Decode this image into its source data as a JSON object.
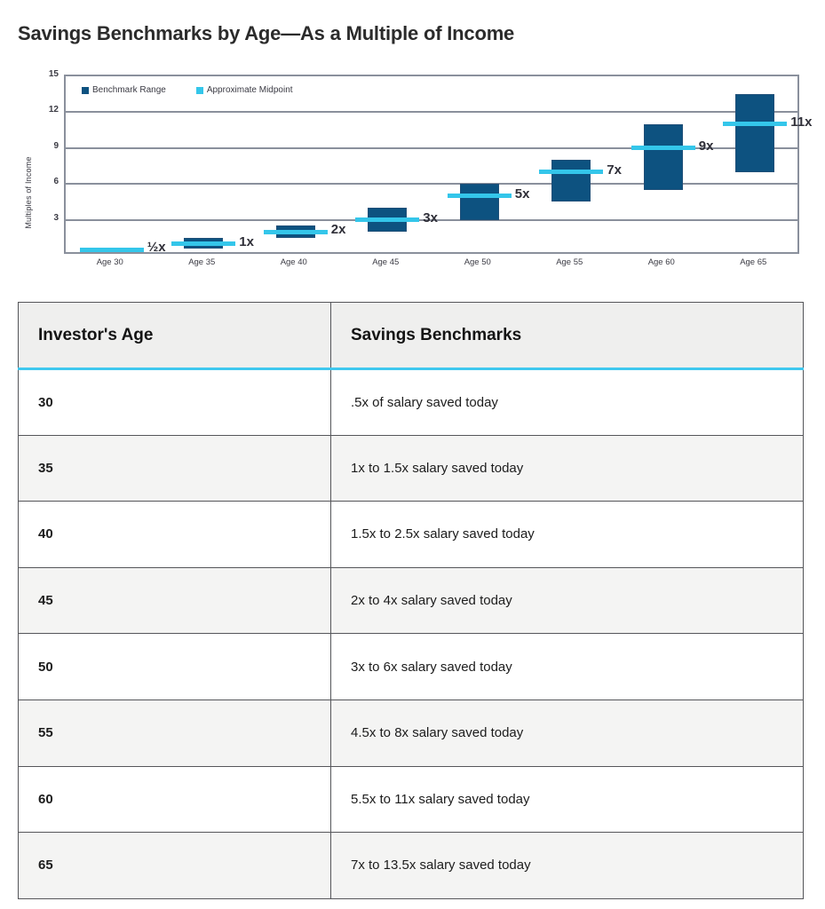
{
  "page": {
    "title": "Savings Benchmarks by Age—As a Multiple of Income"
  },
  "colors": {
    "benchmark_range": "#0d5280",
    "approximate_midpoint": "#34c6ea",
    "gridline": "#8a909c",
    "header_background": "#efefee",
    "header_underline": "#3fc8ef",
    "row_alt_background": "#f4f4f3",
    "text": "#1c1c1c"
  },
  "chart_data": {
    "type": "bar",
    "title": "",
    "xlabel": "",
    "ylabel": "Multiples of Income",
    "ylim": [
      0,
      15
    ],
    "yticks": [
      3,
      6,
      9,
      12,
      15
    ],
    "ytick_labels": [
      "3",
      "6",
      "9",
      "12",
      "15"
    ],
    "grid": true,
    "legend_position": "top-left",
    "legend": [
      {
        "label": "Benchmark Range",
        "color": "#0d5280"
      },
      {
        "label": "Approximate Midpoint",
        "color": "#34c6ea"
      }
    ],
    "categories": [
      "Age 30",
      "Age 35",
      "Age 40",
      "Age 45",
      "Age 50",
      "Age 55",
      "Age 60",
      "Age 65"
    ],
    "series": [
      {
        "name": "Benchmark Range",
        "type": "range",
        "low": [
          0.4,
          0.6,
          1.5,
          2.0,
          3.0,
          4.5,
          5.5,
          7.0
        ],
        "high": [
          0.6,
          1.5,
          2.5,
          4.0,
          6.0,
          8.0,
          11.0,
          13.5
        ]
      },
      {
        "name": "Approximate Midpoint",
        "type": "marker",
        "values": [
          0.5,
          1.0,
          2.0,
          3.0,
          5.0,
          7.0,
          9.0,
          11.0
        ]
      }
    ],
    "point_labels": [
      "½x",
      "1x",
      "2x",
      "3x",
      "5x",
      "7x",
      "9x",
      "11x"
    ]
  },
  "table": {
    "columns": [
      "Investor's Age",
      "Savings Benchmarks"
    ],
    "rows": [
      {
        "age": "30",
        "benchmark": ".5x of salary saved today"
      },
      {
        "age": "35",
        "benchmark": "1x to 1.5x salary saved today"
      },
      {
        "age": "40",
        "benchmark": "1.5x to 2.5x salary saved today"
      },
      {
        "age": "45",
        "benchmark": "2x to 4x salary saved today"
      },
      {
        "age": "50",
        "benchmark": "3x to 6x salary saved today"
      },
      {
        "age": "55",
        "benchmark": "4.5x to 8x salary saved today"
      },
      {
        "age": "60",
        "benchmark": "5.5x to 11x salary saved today"
      },
      {
        "age": "65",
        "benchmark": "7x to 13.5x salary saved today"
      }
    ]
  }
}
